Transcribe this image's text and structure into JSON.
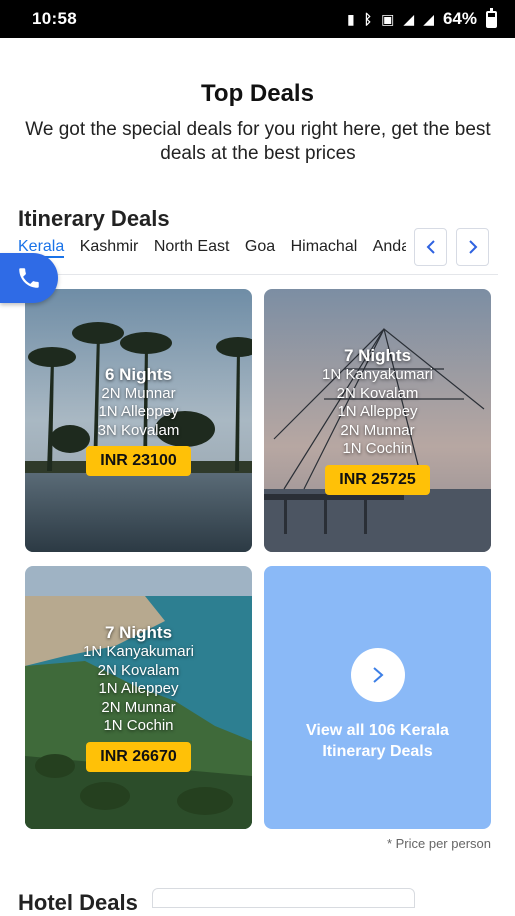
{
  "status_bar": {
    "time": "10:58",
    "battery": "64%",
    "battery_level": 0.64,
    "icons": [
      "vibrate-icon",
      "bluetooth-icon",
      "nfc-icon",
      "4g-signal-icon",
      "signal-icon",
      "battery-icon"
    ]
  },
  "header": {
    "title": "Top Deals",
    "subtitle": "We got the special deals for you right here, get the best deals at the best prices"
  },
  "itinerary": {
    "section_title": "Itinerary Deals",
    "tabs": [
      "Kerala",
      "Kashmir",
      "North East",
      "Goa",
      "Himachal",
      "Anda"
    ],
    "active_tab": "Kerala",
    "cards": [
      {
        "nights": "6 Nights",
        "stops": [
          "2N Munnar",
          "1N Alleppey",
          "3N Kovalam"
        ],
        "price": "INR 23100"
      },
      {
        "nights": "7 Nights",
        "stops": [
          "1N Kanyakumari",
          "2N Kovalam",
          "1N Alleppey",
          "2N Munnar",
          "1N Cochin"
        ],
        "price": "INR 25725"
      },
      {
        "nights": "7 Nights",
        "stops": [
          "1N Kanyakumari",
          "2N Kovalam",
          "1N Alleppey",
          "2N Munnar",
          "1N Cochin"
        ],
        "price": "INR 26670"
      }
    ],
    "view_all": "View all 106 Kerala Itinerary Deals",
    "price_note": "* Price per person"
  },
  "hotel": {
    "section_title": "Hotel Deals"
  },
  "colors": {
    "accent": "#1a73e8",
    "fab": "#2f6be6",
    "price_badge": "#ffc107",
    "view_all_card": "#8ab9f7"
  }
}
